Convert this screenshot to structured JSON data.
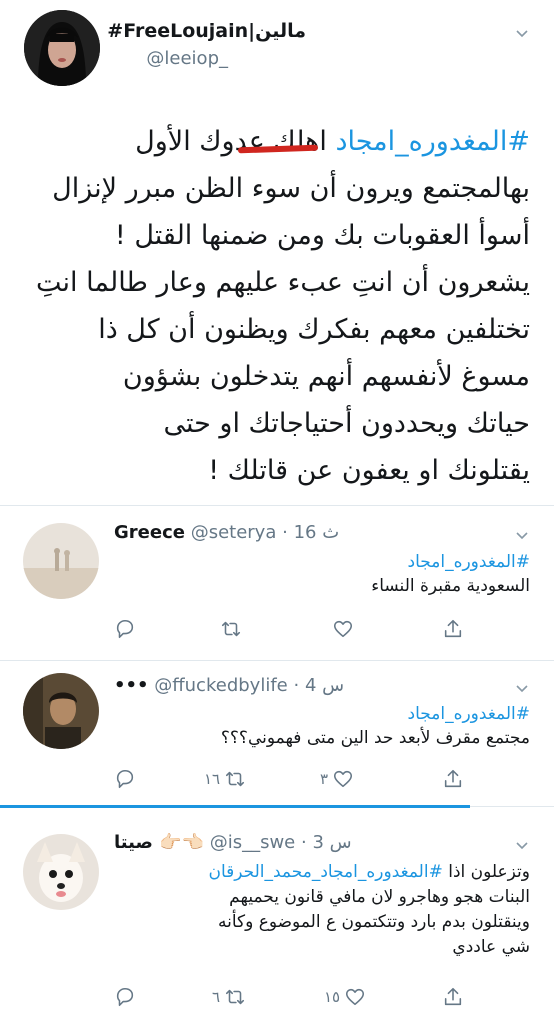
{
  "main_tweet": {
    "display_name": "#FreeLoujain|مالين",
    "handle": "@leeiop_",
    "hashtag": "#المغدوره_امجاد",
    "lines": [
      "اهلك عدوك الأول",
      "بهالمجتمع ويرون أن سوء الظن مبرر لإنزال",
      "أسوأ العقوبات بك ومن ضمنها القتل !",
      "يشعرون أن انتِ عبء عليهم وعار طالما انتِ",
      "تختلفين معهم بفكرك ويظنون أن كل ذا",
      "مسوغ لأنفسهم أنهم يتدخلون بشؤون",
      "حياتك ويحددون أحتياجاتك او حتى",
      "يقتلونك او يعفون عن قاتلك !"
    ]
  },
  "replies": [
    {
      "display_name": "Greece",
      "handle": "@seterya",
      "time": "16 ث",
      "hashtag": "#المغدوره_امجاد",
      "lines": [
        "السعودية مقبرة النساء"
      ],
      "reply_count": "",
      "retweet_count": "",
      "like_count": ""
    },
    {
      "display_name": "•••",
      "handle": "@ffuckedbylife",
      "time": "4 س",
      "hashtag": "#المغدوره_امجاد",
      "lines": [
        "مجتمع مقرف لأبعد حد الين متى فهموني؟؟؟"
      ],
      "reply_count": "",
      "retweet_count": "١٦",
      "like_count": "٣"
    },
    {
      "display_name": "صيتا 👉🏻👈🏻",
      "handle": "@is__swe",
      "time": "3 س",
      "hashtag": "#المغدوره_امجاد_محمد_الحرقان",
      "first_line_rest": "وتزعلون اذا",
      "lines": [
        "البنات هجو وهاجرو لان مافي قانون يحميهم",
        "وينقتلون بدم بارد وتتكتمون ع الموضوع وكأنه",
        "شي عاددي"
      ],
      "reply_count": "",
      "retweet_count": "٦",
      "like_count": "١٥"
    }
  ],
  "icons": {
    "reply": "reply-icon",
    "retweet": "retweet-icon",
    "like": "heart-icon",
    "share": "share-icon",
    "menu": "chevron-down-icon"
  },
  "colors": {
    "link": "#1b95e0",
    "muted": "#657786",
    "underline": "#d0261f",
    "separator": "#e1e8ed"
  }
}
